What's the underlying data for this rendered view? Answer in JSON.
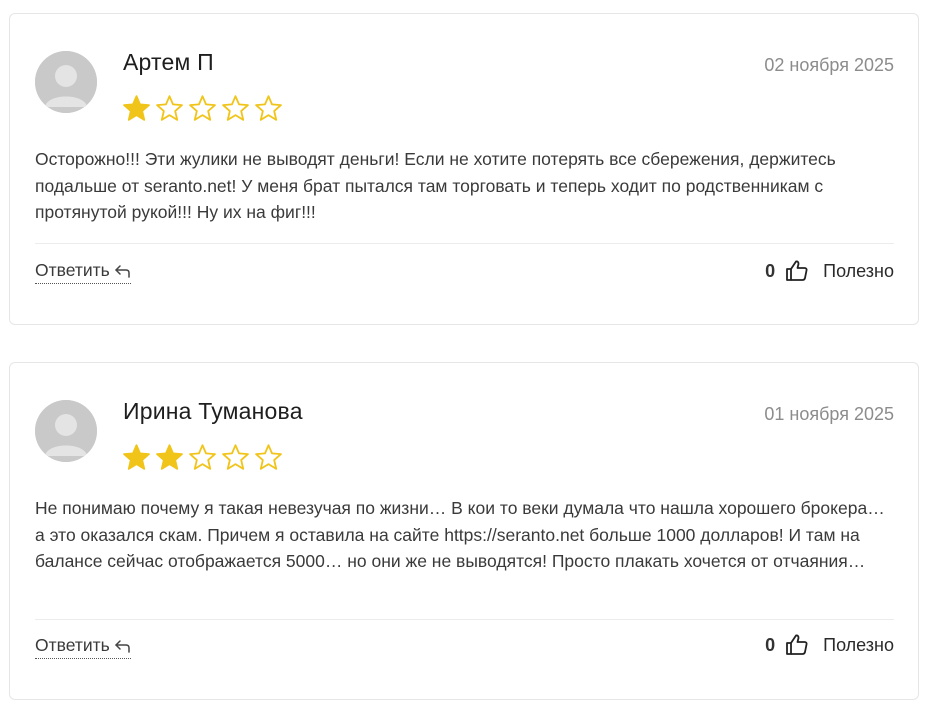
{
  "colors": {
    "star_filled": "#f0c419",
    "star_empty_outline": "#f0c419",
    "avatar_bg": "#c8c8c8"
  },
  "reviews": [
    {
      "author": "Артем П",
      "date": "02 ноября 2025",
      "rating": 1,
      "max_rating": 5,
      "text": "Осторожно!!! Эти жулики не выводят деньги! Если не хотите потерять все сбережения, держитесь подальше от seranto.net! У меня брат пытался там торговать и теперь ходит по родственникам с протянутой рукой!!! Ну их на фиг!!!",
      "reply_label": "Ответить",
      "helpful_count": "0",
      "helpful_label": "Полезно"
    },
    {
      "author": "Ирина Туманова",
      "date": "01 ноября 2025",
      "rating": 2,
      "max_rating": 5,
      "text": "Не понимаю почему я такая невезучая по жизни… В кои то веки думала что нашла хорошего брокера… а это оказался скам. Причем я оставила на сайте https://seranto.net больше 1000 долларов! И там на балансе сейчас отображается 5000… но они же не выводятся! Просто плакать хочется от отчаяния…",
      "reply_label": "Ответить",
      "helpful_count": "0",
      "helpful_label": "Полезно"
    }
  ]
}
